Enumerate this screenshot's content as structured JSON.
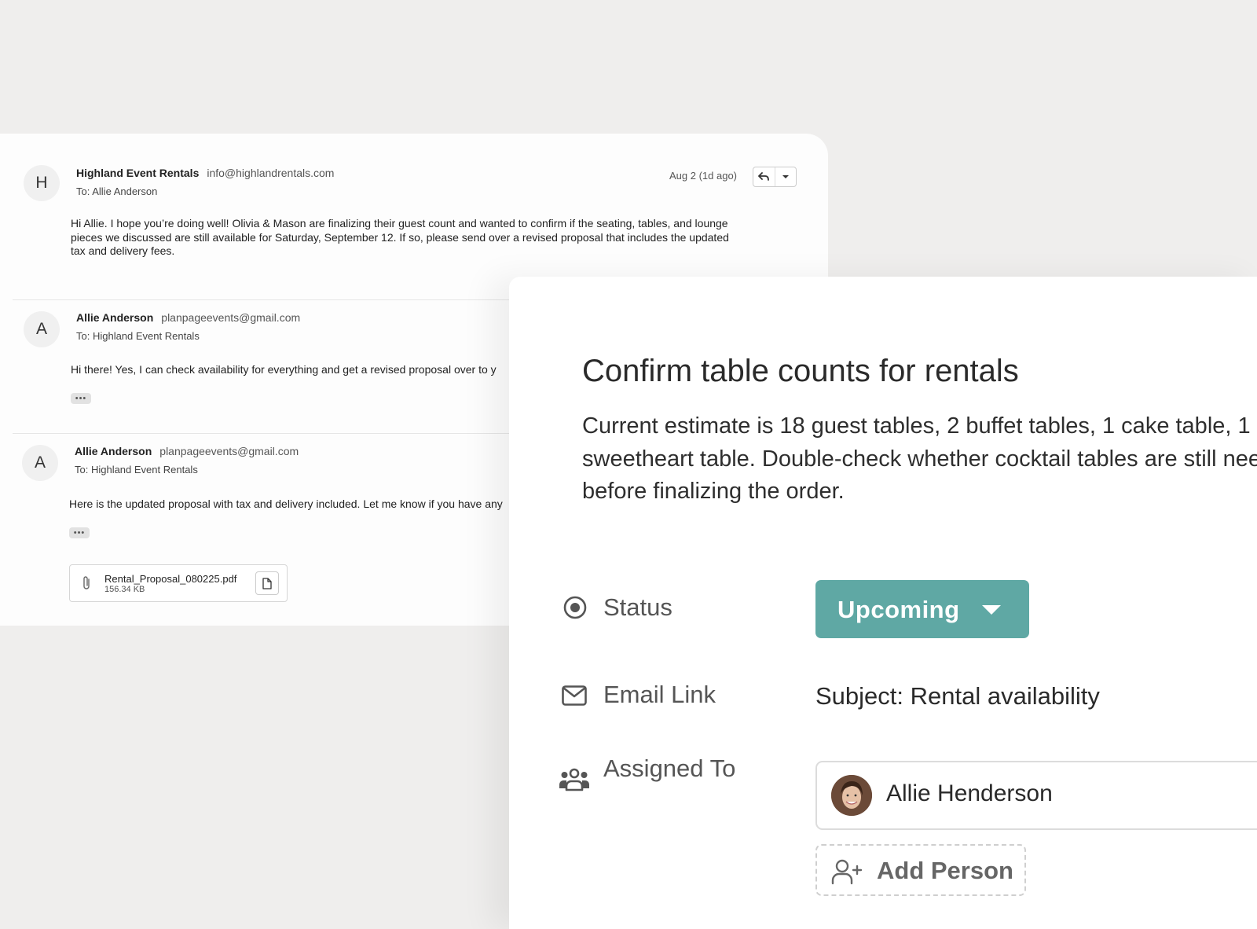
{
  "email_thread": {
    "messages": [
      {
        "avatar": "H",
        "sender_name": "Highland Event Rentals",
        "sender_email": "info@highlandrentals.com",
        "to": "To: Allie Anderson",
        "date": "Aug 2 (1d ago)",
        "body": "Hi Allie. I hope you’re doing well! Olivia & Mason are finalizing their guest count and wanted to confirm if the seating, tables, and lounge pieces we discussed are still available for Saturday, September 12. If so, please send over a revised proposal that includes the updated tax and delivery fees."
      },
      {
        "avatar": "A",
        "sender_name": "Allie Anderson",
        "sender_email": "planpageevents@gmail.com",
        "to": "To: Highland Event Rentals",
        "body": "Hi there! Yes, I can check availability for everything and get a revised proposal over to y"
      },
      {
        "avatar": "A",
        "sender_name": "Allie Anderson",
        "sender_email": "planpageevents@gmail.com",
        "to": "To: Highland Event Rentals",
        "body": "Here is the updated proposal with tax and delivery included. Let me know if you have any",
        "attachment": {
          "file_name": "Rental_Proposal_080225.pdf",
          "file_size": "156.34 KB"
        }
      }
    ],
    "ellipsis": "•••"
  },
  "task": {
    "title": "Confirm table counts for rentals",
    "description": "Current estimate is 18 guest tables, 2 buffet tables, 1 cake table, 1 sweetheart table. Double-check whether cocktail tables are still needed before finalizing the order.",
    "fields": {
      "status_label": "Status",
      "status_value": "Upcoming",
      "email_label": "Email Link",
      "email_value": "Subject: Rental availability",
      "assigned_label": "Assigned To",
      "assignee_name": "Allie Henderson",
      "add_person_label": "Add Person"
    }
  },
  "colors": {
    "status_button": "#5fa8a4",
    "background": "#efeeed"
  },
  "icons": [
    "reply-icon",
    "chevron-down-icon",
    "paperclip-icon",
    "file-icon",
    "radio-target-icon",
    "envelope-icon",
    "users-icon",
    "user-plus-icon"
  ]
}
